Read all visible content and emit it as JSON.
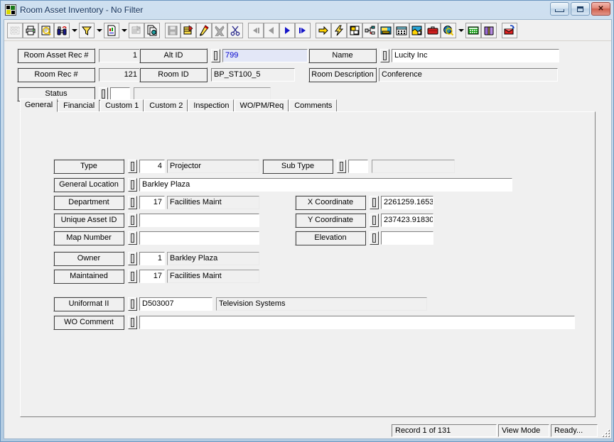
{
  "window": {
    "title": "Room Asset Inventory - No Filter",
    "app_icon": "app-window-icon",
    "minimize_label": "",
    "restore_label": "",
    "close_label": "✕"
  },
  "toolbar": {
    "buttons": [
      {
        "name": "select-grid-icon",
        "disabled": true
      },
      {
        "name": "print-icon",
        "disabled": false
      },
      {
        "name": "print-preview-icon",
        "disabled": false
      },
      {
        "name": "find-binoculars-icon",
        "disabled": false
      },
      {
        "name": "find-dropdown-caret-icon",
        "disabled": false
      },
      {
        "name": "filter-funnel-icon",
        "disabled": false
      },
      {
        "name": "filter-dropdown-caret-icon",
        "disabled": false
      },
      {
        "name": "report-icon",
        "disabled": false
      },
      {
        "name": "report-dropdown-caret-icon",
        "disabled": false
      },
      {
        "name": "form-designer-icon",
        "disabled": true
      },
      {
        "name": "copy-record-icon",
        "disabled": false
      },
      {
        "name": "save-icon",
        "disabled": true
      },
      {
        "name": "add-record-icon",
        "disabled": false
      },
      {
        "name": "edit-record-icon",
        "disabled": false
      },
      {
        "name": "delete-record-icon",
        "disabled": false
      },
      {
        "name": "cut-scissors-icon",
        "disabled": false
      },
      {
        "name": "first-record-icon",
        "disabled": true
      },
      {
        "name": "previous-record-icon",
        "disabled": true
      },
      {
        "name": "next-record-icon",
        "disabled": false
      },
      {
        "name": "last-record-icon",
        "disabled": false
      },
      {
        "name": "go-to-icon",
        "disabled": false
      },
      {
        "name": "quick-action-icon",
        "disabled": false
      },
      {
        "name": "attachments-icon",
        "disabled": false
      },
      {
        "name": "hierarchy-icon",
        "disabled": false
      },
      {
        "name": "work-order-icon",
        "disabled": false
      },
      {
        "name": "pm-schedule-icon",
        "disabled": false
      },
      {
        "name": "gis-map-icon",
        "disabled": false
      },
      {
        "name": "toolbox-icon",
        "disabled": false
      },
      {
        "name": "web-search-icon",
        "disabled": false
      },
      {
        "name": "web-search-dropdown-caret-icon",
        "disabled": false
      },
      {
        "name": "calculator-icon",
        "disabled": false
      },
      {
        "name": "help-book-icon",
        "disabled": false
      },
      {
        "name": "export-icon",
        "disabled": false
      }
    ]
  },
  "header": {
    "room_asset_rec_label": "Room Asset Rec #",
    "room_asset_rec_value": "1",
    "room_rec_label": "Room Rec #",
    "room_rec_value": "121",
    "status_label": "Status",
    "status_code": "",
    "status_desc": "",
    "alt_id_label": "Alt ID",
    "alt_id_value": "799",
    "room_id_label": "Room ID",
    "room_id_value": "BP_ST100_5",
    "name_label": "Name",
    "name_value": "Lucity Inc",
    "room_description_label": "Room Description",
    "room_description_value": "Conference"
  },
  "tabs": [
    {
      "label": "General",
      "active": true
    },
    {
      "label": "Financial",
      "active": false
    },
    {
      "label": "Custom 1",
      "active": false
    },
    {
      "label": "Custom 2",
      "active": false
    },
    {
      "label": "Inspection",
      "active": false
    },
    {
      "label": "WO/PM/Req",
      "active": false
    },
    {
      "label": "Comments",
      "active": false
    }
  ],
  "general_tab": {
    "type_label": "Type",
    "type_code": "4",
    "type_desc": "Projector",
    "sub_type_label": "Sub Type",
    "sub_type_code": "",
    "sub_type_desc": "",
    "general_location_label": "General Location",
    "general_location_value": "Barkley Plaza",
    "department_label": "Department",
    "department_code": "17",
    "department_desc": "Facilities Maint",
    "unique_asset_id_label": "Unique Asset ID",
    "unique_asset_id_value": "",
    "map_number_label": "Map Number",
    "map_number_value": "",
    "owner_label": "Owner",
    "owner_code": "1",
    "owner_desc": "Barkley Plaza",
    "maintained_label": "Maintained",
    "maintained_code": "17",
    "maintained_desc": "Facilities Maint",
    "x_coordinate_label": "X Coordinate",
    "x_coordinate_value": "2261259.1653",
    "y_coordinate_label": "Y Coordinate",
    "y_coordinate_value": "237423.91830",
    "elevation_label": "Elevation",
    "elevation_value": "",
    "uniformat_label": "Uniformat II",
    "uniformat_code": "D503007",
    "uniformat_desc": "Television Systems",
    "wo_comment_label": "WO Comment",
    "wo_comment_value": ""
  },
  "statusbar": {
    "record_position": "Record 1 of 131",
    "mode": "View Mode",
    "state": "Ready..."
  },
  "colors": {
    "titlebar_text": "#11305a",
    "selected_field_bg": "#e3e7f7",
    "selected_field_text": "#0000cd",
    "face": "#f0f0f0"
  }
}
